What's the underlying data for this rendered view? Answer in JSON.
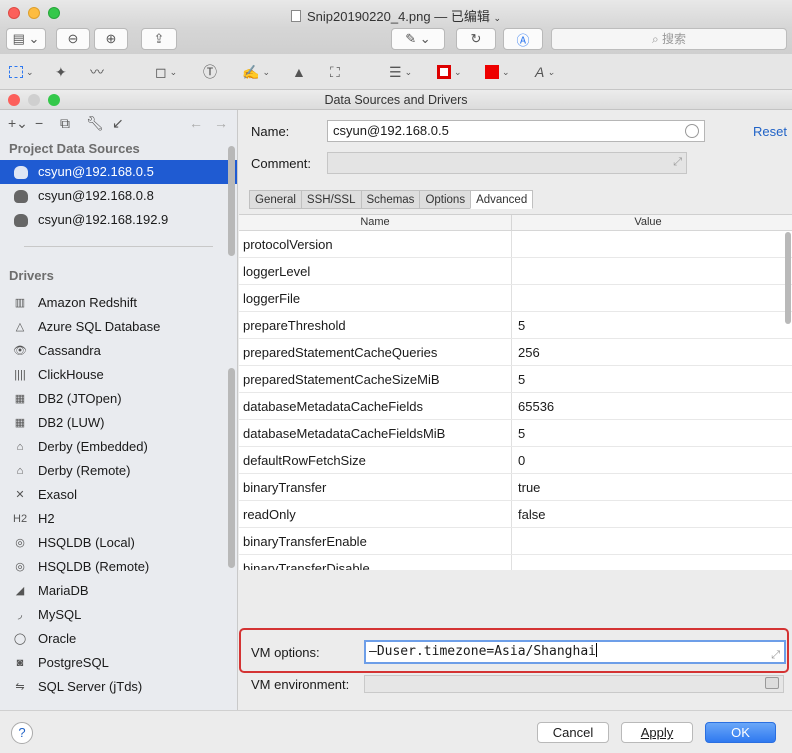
{
  "outer": {
    "title": "Snip20190220_4.png — 已编辑",
    "search_placeholder": "搜索"
  },
  "dialog": {
    "title": "Data Sources and Drivers"
  },
  "left": {
    "project_header": "Project Data Sources",
    "datasources": [
      "csyun@192.168.0.5",
      "csyun@192.168.0.8",
      "csyun@192.168.192.9"
    ],
    "drivers_header": "Drivers",
    "drivers": [
      "Amazon Redshift",
      "Azure SQL Database",
      "Cassandra",
      "ClickHouse",
      "DB2 (JTOpen)",
      "DB2 (LUW)",
      "Derby (Embedded)",
      "Derby (Remote)",
      "Exasol",
      "H2",
      "HSQLDB (Local)",
      "HSQLDB (Remote)",
      "MariaDB",
      "MySQL",
      "Oracle",
      "PostgreSQL",
      "SQL Server (jTds)"
    ]
  },
  "form": {
    "name_label": "Name:",
    "name_value": "csyun@192.168.0.5",
    "reset": "Reset",
    "comment_label": "Comment:",
    "tabs": [
      "General",
      "SSH/SSL",
      "Schemas",
      "Options",
      "Advanced"
    ],
    "col_name": "Name",
    "col_value": "Value",
    "rows": [
      [
        "protocolVersion",
        ""
      ],
      [
        "loggerLevel",
        ""
      ],
      [
        "loggerFile",
        ""
      ],
      [
        "prepareThreshold",
        "5"
      ],
      [
        "preparedStatementCacheQueries",
        "256"
      ],
      [
        "preparedStatementCacheSizeMiB",
        "5"
      ],
      [
        "databaseMetadataCacheFields",
        "65536"
      ],
      [
        "databaseMetadataCacheFieldsMiB",
        "5"
      ],
      [
        "defaultRowFetchSize",
        "0"
      ],
      [
        "binaryTransfer",
        "true"
      ],
      [
        "readOnly",
        "false"
      ],
      [
        "binaryTransferEnable",
        ""
      ],
      [
        "binaryTransferDisable",
        ""
      ]
    ],
    "vm_options_label": "VM options:",
    "vm_options_value": "—Duser.timezone=Asia/Shanghai",
    "vm_env_label": "VM environment:"
  },
  "buttons": {
    "cancel": "Cancel",
    "apply": "Apply",
    "ok": "OK",
    "help": "?"
  }
}
